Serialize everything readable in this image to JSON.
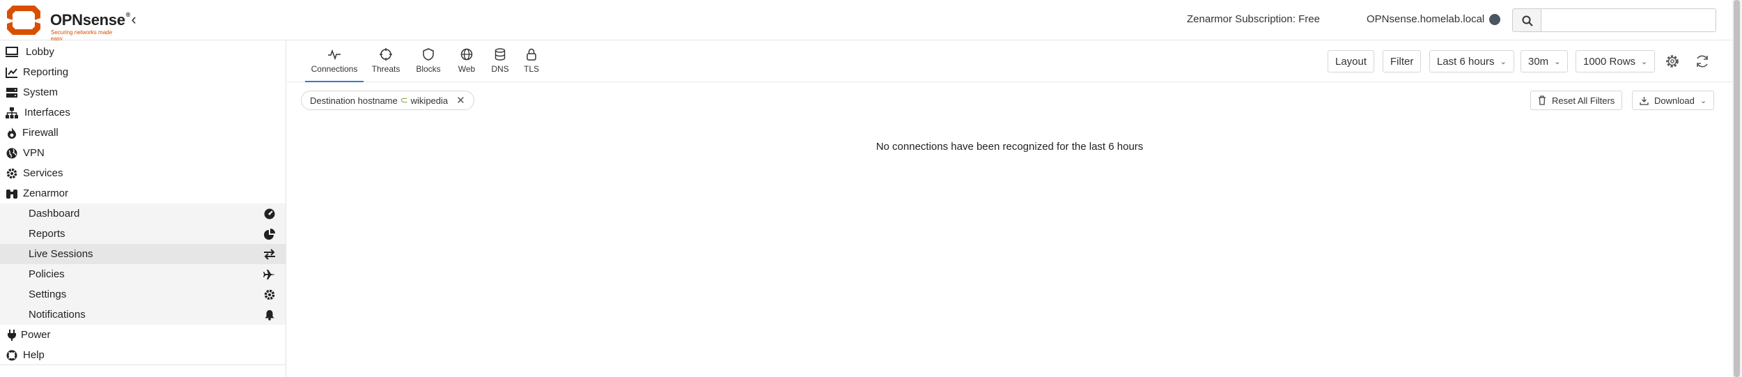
{
  "brand": {
    "name": "OPNsense",
    "tagline": "Securing networks made easy",
    "color": "#d94f00"
  },
  "topbar": {
    "subscription": "Zenarmor Subscription: Free",
    "hostname": "OPNsense.homelab.local",
    "search_placeholder": "",
    "icons": [
      "chevron-left-icon",
      "status-dot",
      "search-icon"
    ]
  },
  "sidebar": {
    "items": [
      {
        "label": "Lobby",
        "icon": "monitor-icon"
      },
      {
        "label": "Reporting",
        "icon": "chart-icon"
      },
      {
        "label": "System",
        "icon": "server-icon"
      },
      {
        "label": "Interfaces",
        "icon": "sitemap-icon"
      },
      {
        "label": "Firewall",
        "icon": "fire-icon"
      },
      {
        "label": "VPN",
        "icon": "globe-icon"
      },
      {
        "label": "Services",
        "icon": "cog-icon"
      },
      {
        "label": "Zenarmor",
        "icon": "binoculars-icon"
      }
    ],
    "subitems": [
      {
        "label": "Dashboard",
        "icon": "dashboard-icon"
      },
      {
        "label": "Reports",
        "icon": "pie-chart-icon"
      },
      {
        "label": "Live Sessions",
        "icon": "exchange-icon",
        "active": true
      },
      {
        "label": "Policies",
        "icon": "plane-icon"
      },
      {
        "label": "Settings",
        "icon": "cog-icon"
      },
      {
        "label": "Notifications",
        "icon": "bell-icon"
      }
    ],
    "bottom_items": [
      {
        "label": "Power",
        "icon": "plug-icon"
      },
      {
        "label": "Help",
        "icon": "life-ring-icon"
      }
    ]
  },
  "tabs": [
    {
      "label": "Connections",
      "icon": "activity-icon",
      "active": true
    },
    {
      "label": "Threats",
      "icon": "crosshair-icon"
    },
    {
      "label": "Blocks",
      "icon": "shield-icon"
    },
    {
      "label": "Web",
      "icon": "globe-icon"
    },
    {
      "label": "DNS",
      "icon": "database-icon"
    },
    {
      "label": "TLS",
      "icon": "lock-icon"
    }
  ],
  "toolbar": {
    "layout": "Layout",
    "filter": "Filter",
    "time_range": "Last 6 hours",
    "interval": "30m",
    "rows": "1000 Rows"
  },
  "filter_chip": {
    "field": "Destination hostname",
    "operator": "⊂",
    "value": "wikipedia"
  },
  "actions": {
    "reset": "Reset All Filters",
    "download": "Download"
  },
  "empty_message": "No connections have been recognized for the last 6 hours",
  "colors": {
    "accent": "#2e7bd1",
    "operator": "#7aa33a",
    "sidebar_active": "#e6e6e6",
    "sidebar_sub": "#f4f4f4"
  }
}
